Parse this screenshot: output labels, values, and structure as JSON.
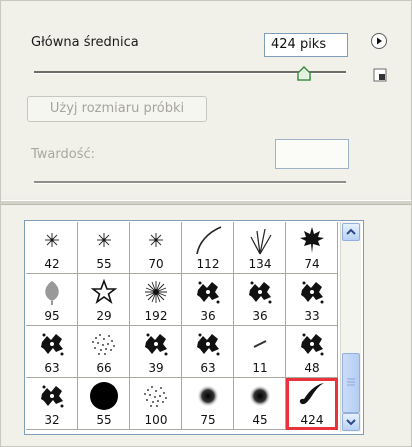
{
  "master_diameter": {
    "label": "Główna średnica",
    "value": "424 piks"
  },
  "use_sample_size_button": "Użyj rozmiaru próbki",
  "hardness": {
    "label": "Twardość:",
    "value": ""
  },
  "icons": {
    "menu": "flyout-menu-icon",
    "new_preset": "new-preset-icon"
  },
  "brushes": [
    {
      "size": "42",
      "shape": "star-small"
    },
    {
      "size": "55",
      "shape": "star-small"
    },
    {
      "size": "70",
      "shape": "star-small"
    },
    {
      "size": "112",
      "shape": "grass-blade"
    },
    {
      "size": "134",
      "shape": "grass-tuft"
    },
    {
      "size": "74",
      "shape": "maple-leaf"
    },
    {
      "size": "95",
      "shape": "leaf"
    },
    {
      "size": "29",
      "shape": "star-outline"
    },
    {
      "size": "192",
      "shape": "starburst"
    },
    {
      "size": "36",
      "shape": "texture-splatter"
    },
    {
      "size": "36",
      "shape": "texture-splatter"
    },
    {
      "size": "33",
      "shape": "texture-splatter"
    },
    {
      "size": "63",
      "shape": "texture-splatter"
    },
    {
      "size": "66",
      "shape": "noise"
    },
    {
      "size": "39",
      "shape": "texture-splatter"
    },
    {
      "size": "63",
      "shape": "texture-splatter"
    },
    {
      "size": "11",
      "shape": "small-stroke"
    },
    {
      "size": "48",
      "shape": "texture-splatter"
    },
    {
      "size": "32",
      "shape": "texture-splatter"
    },
    {
      "size": "55",
      "shape": "hard-round"
    },
    {
      "size": "100",
      "shape": "noise"
    },
    {
      "size": "75",
      "shape": "soft-round"
    },
    {
      "size": "45",
      "shape": "soft-round"
    },
    {
      "size": "424",
      "shape": "brush-stroke"
    }
  ],
  "selected_brush_index": 23,
  "colors": {
    "selection": "#e8333d",
    "accent": "#7f9db9"
  }
}
